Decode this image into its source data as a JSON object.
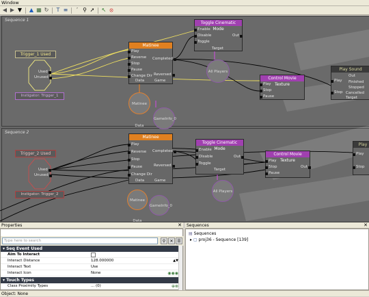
{
  "window": {
    "title": "Window"
  },
  "toolbar": {
    "icons": [
      "back-icon",
      "forward-icon",
      "dropdown-icon",
      "up-icon",
      "grid-icon",
      "refresh-icon",
      "filter-icon",
      "tools-icon",
      "search-icon",
      "zoom-icon",
      "link-icon",
      "arrow-icon",
      "stop-icon"
    ]
  },
  "canvas": {
    "seq1": {
      "label": "Sequence 1",
      "event": "Trigger_1 Used",
      "event_ports": [
        "Used",
        "Unused"
      ],
      "instigator": "Instigator: Trigger_1",
      "matinee": {
        "title": "Matinee",
        "ports": [
          "Play",
          "Reverse",
          "Stop",
          "Pause",
          "Change Dir"
        ],
        "out_ports": [
          "Completed",
          "Reversed"
        ],
        "bottom": [
          "Data",
          "Game"
        ]
      },
      "toggle": {
        "title": "Toggle Cinematic Mode",
        "ports": [
          "Enable",
          "Disable",
          "Toggle"
        ],
        "out": "Out",
        "target": "Target"
      },
      "control_movie": {
        "title": "Control Movie Texture",
        "ports": [
          "Play",
          "Stop",
          "Pause"
        ]
      },
      "play_sound": {
        "title": "Play Sound",
        "ports": [
          "Play",
          "Stop"
        ],
        "out_ports": [
          "Out",
          "Finished",
          "Stopped",
          "Cancelled"
        ],
        "target": "Target"
      },
      "vars": {
        "matinee_data": "Matinee Data",
        "game": "GameInfo_0",
        "all_players": "All Players"
      }
    },
    "seq2": {
      "label": "Sequence 2",
      "event": "Trigger_2 Used",
      "event_ports": [
        "Used",
        "Unused"
      ],
      "instigator": "Instigator: Trigger_2",
      "matinee": {
        "title": "Matinee",
        "ports": [
          "Play",
          "Reverse",
          "Stop",
          "Pause",
          "Change Dir"
        ],
        "out_ports": [
          "Completed",
          "Reversed"
        ],
        "bottom": [
          "Data",
          "Game"
        ]
      },
      "toggle": {
        "title": "Toggle Cinematic Mode",
        "ports": [
          "Enable",
          "Disable",
          "Toggle"
        ],
        "out": "Out",
        "target": "Target"
      },
      "control_movie": {
        "title": "Control Movie Texture",
        "ports": [
          "Play",
          "Stop",
          "Pause"
        ],
        "out": "Out"
      },
      "play_sound": {
        "title": "Play Sound",
        "ports": [
          "Play",
          "Stop"
        ]
      },
      "vars": {
        "matinee_data": "Matinee Data",
        "game": "GameInfo_0",
        "all_players": "All Players"
      }
    }
  },
  "properties": {
    "title": "Properties",
    "search_placeholder": "Type here to search",
    "categories": [
      {
        "name": "Seq Event Used",
        "rows": [
          {
            "key": "Aim To Interact",
            "value": "",
            "checkbox": true
          },
          {
            "key": "Interact Distance",
            "value": "128.000000"
          },
          {
            "key": "Interact Text",
            "value": "Use"
          },
          {
            "key": "Interact Icon",
            "value": "None"
          }
        ]
      },
      {
        "name": "Touch Types",
        "rows": [
          {
            "key": "Class Proximity Types",
            "value": "... (0)"
          }
        ]
      }
    ]
  },
  "sequences": {
    "title": "Sequences",
    "root": "Sequences",
    "item": "proj36 - Sequence [139]"
  },
  "status": {
    "text": "Object: None"
  }
}
